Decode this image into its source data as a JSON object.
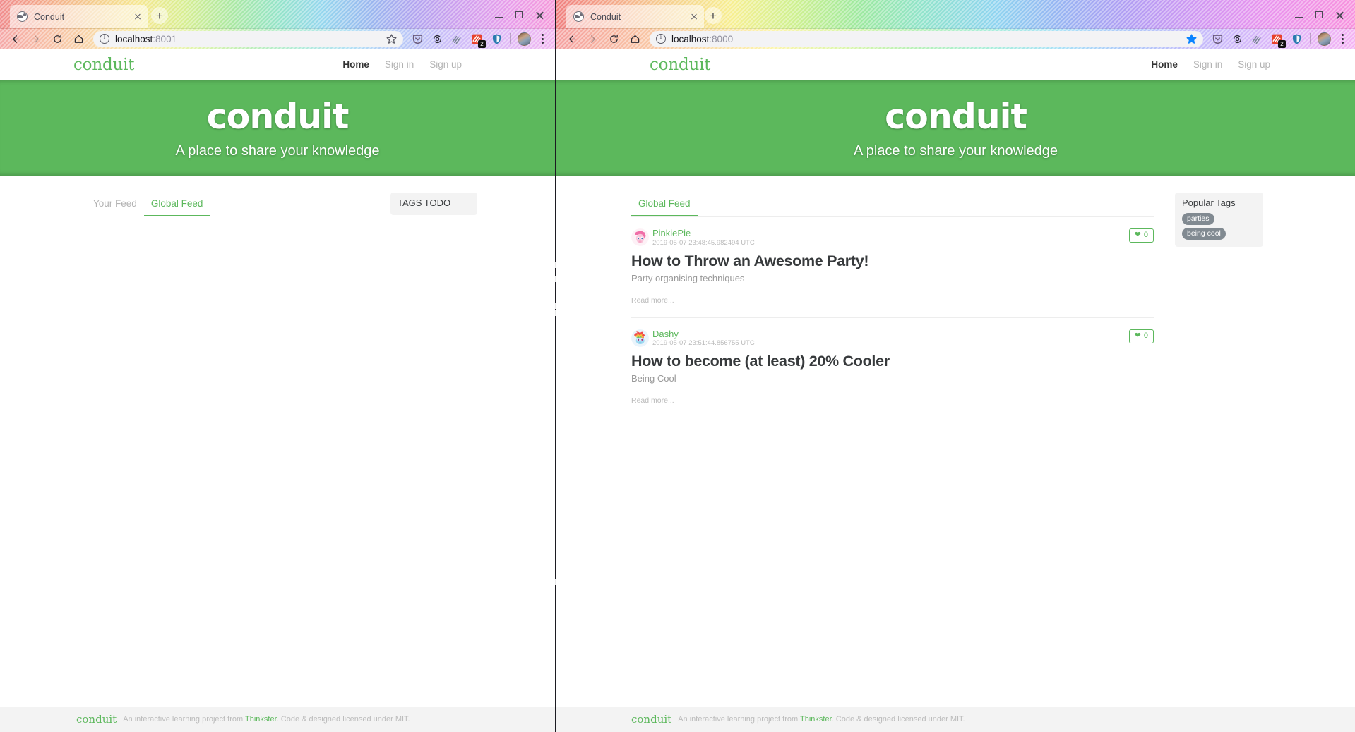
{
  "windows": [
    {
      "id": "left",
      "tab": {
        "title": "Conduit",
        "favicon": "globe-icon"
      },
      "url": {
        "host": "localhost",
        "port": ":8001",
        "info_icon": "info-circle-icon",
        "bookmarked": false
      },
      "nav": {
        "back": "back-arrow-icon",
        "forward": "forward-arrow-icon",
        "reload": "reload-icon",
        "home": "home-icon"
      },
      "toolbar_icons": [
        "star-icon",
        "pocket-icon",
        "sync-icon",
        "reader-icon",
        "ublock-icon",
        "shield-icon"
      ],
      "extension_badge": "2",
      "window_controls": {
        "minimize": "minimize-icon",
        "maximize": "maximize-icon",
        "close": "close-icon"
      },
      "site": {
        "brand": "conduit",
        "nav_links": [
          {
            "label": "Home",
            "active": true
          },
          {
            "label": "Sign in",
            "active": false
          },
          {
            "label": "Sign up",
            "active": false
          }
        ],
        "banner": {
          "title": "conduit",
          "subtitle": "A place to share your knowledge"
        },
        "feed_tabs": [
          {
            "label": "Your Feed",
            "active": false
          },
          {
            "label": "Global Feed",
            "active": true
          }
        ],
        "articles": [],
        "sidebar": {
          "title": "TAGS TODO",
          "tags": []
        },
        "footer": {
          "brand": "conduit",
          "text_before": "An interactive learning project from ",
          "link": "Thinkster",
          "text_after": ". Code & designed licensed under MIT."
        }
      }
    },
    {
      "id": "right",
      "tab": {
        "title": "Conduit",
        "favicon": "globe-icon"
      },
      "url": {
        "host": "localhost",
        "port": ":8000",
        "info_icon": "info-circle-icon",
        "bookmarked": true
      },
      "nav": {
        "back": "back-arrow-icon",
        "forward": "forward-arrow-icon",
        "reload": "reload-icon",
        "home": "home-icon"
      },
      "toolbar_icons": [
        "star-icon",
        "pocket-icon",
        "sync-icon",
        "reader-icon",
        "ublock-icon",
        "shield-icon"
      ],
      "extension_badge": "2",
      "window_controls": {
        "minimize": "minimize-icon",
        "maximize": "maximize-icon",
        "close": "close-icon"
      },
      "site": {
        "brand": "conduit",
        "nav_links": [
          {
            "label": "Home",
            "active": true
          },
          {
            "label": "Sign in",
            "active": false
          },
          {
            "label": "Sign up",
            "active": false
          }
        ],
        "banner": {
          "title": "conduit",
          "subtitle": "A place to share your knowledge"
        },
        "feed_tabs": [
          {
            "label": "Global Feed",
            "active": true
          }
        ],
        "articles": [
          {
            "author": "PinkiePie",
            "avatar": "pinkiepie-avatar",
            "date": "2019-05-07 23:48:45.982494 UTC",
            "title": "How to Throw an Awesome Party!",
            "description": "Party organising techniques",
            "read_more": "Read more...",
            "favorites": "0",
            "heart_icon": "heart-icon"
          },
          {
            "author": "Dashy",
            "avatar": "rainbowdash-avatar",
            "date": "2019-05-07 23:51:44.856755 UTC",
            "title": "How to become (at least) 20% Cooler",
            "description": "Being Cool",
            "read_more": "Read more...",
            "favorites": "0",
            "heart_icon": "heart-icon"
          }
        ],
        "sidebar": {
          "title": "Popular Tags",
          "tags": [
            "parties",
            "being cool"
          ]
        },
        "footer": {
          "brand": "conduit",
          "text_before": "An interactive learning project from ",
          "link": "Thinkster",
          "text_after": ". Code & designed licensed under MIT."
        }
      }
    }
  ],
  "colors": {
    "brand_green": "#5cb85c",
    "tag_grey": "#818a91",
    "footer_bg": "#f3f3f3",
    "bookmark_blue": "#0a84ff"
  }
}
